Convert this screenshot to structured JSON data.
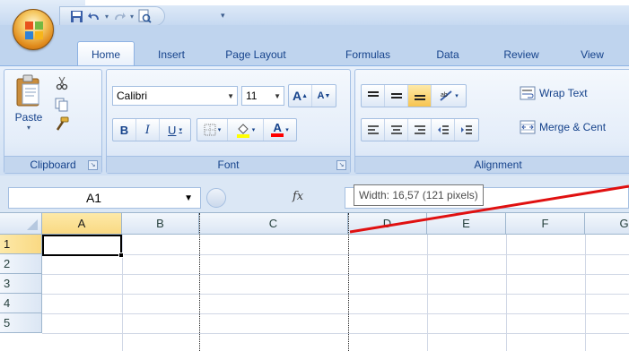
{
  "quick_access": {
    "more_label": "▾"
  },
  "tabs": [
    {
      "label": "Home",
      "active": true
    },
    {
      "label": "Insert",
      "active": false
    },
    {
      "label": "Page Layout",
      "active": false
    },
    {
      "label": "Formulas",
      "active": false
    },
    {
      "label": "Data",
      "active": false
    },
    {
      "label": "Review",
      "active": false
    },
    {
      "label": "View",
      "active": false
    }
  ],
  "clipboard": {
    "paste_label": "Paste",
    "group_label": "Clipboard",
    "launcher": "↘"
  },
  "font": {
    "family": "Calibri",
    "size": "11",
    "grow_label": "A",
    "shrink_label": "A",
    "bold_label": "B",
    "italic_label": "I",
    "underline_label": "U",
    "font_color_label": "A",
    "group_label": "Font",
    "launcher": "↘"
  },
  "alignment": {
    "wrap_text_label": "Wrap Text",
    "merge_label": "Merge & Cent",
    "group_label": "Alignment"
  },
  "formula_bar": {
    "name_box": "A1",
    "fx_label": "fx",
    "value": ""
  },
  "tooltip": {
    "text": "Width: 16,57 (121 pixels)"
  },
  "grid": {
    "columns": [
      "A",
      "B",
      "C",
      "D",
      "E",
      "F",
      "G"
    ],
    "rows": [
      "1",
      "2",
      "3",
      "4",
      "5"
    ],
    "selected_column": "A",
    "selected_row": "1"
  },
  "colors": {
    "accent_red": "#e01010",
    "font_color_bar": "#ff0000",
    "fill_color_bar": "#ffff00",
    "selected_header": "#f9d983"
  }
}
